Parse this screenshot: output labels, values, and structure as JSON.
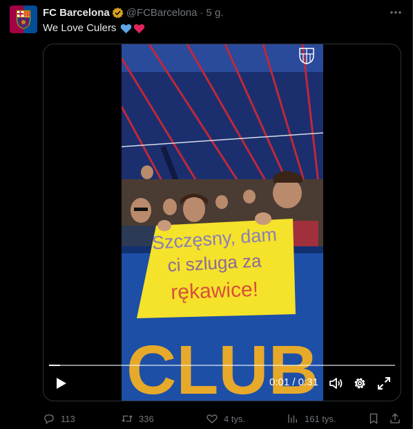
{
  "post": {
    "author_name": "FC Barcelona",
    "author_handle": "@FCBarcelona",
    "separator": "·",
    "timestamp": "5 g.",
    "text": "We Love Culers",
    "verified_badge_color": "#d6a21e"
  },
  "video": {
    "current_time": "0:01",
    "duration": "0:31",
    "time_separator": "/",
    "progress_fraction": 0.032,
    "banner_lines": [
      "Szczęsny, dam",
      "ci szluga za",
      "rękawice!"
    ],
    "seat_lettering": "CLUB"
  },
  "actions": {
    "reply_count": "113",
    "retweet_count": "336",
    "like_count": "4 tys.",
    "views_count": "161 tys."
  },
  "colors": {
    "background": "#000000",
    "text_primary": "#e7e9ea",
    "text_secondary": "#71767b",
    "border": "#2f3336",
    "heart_blue": "#5ea8e6",
    "heart_red": "#e0245e"
  }
}
